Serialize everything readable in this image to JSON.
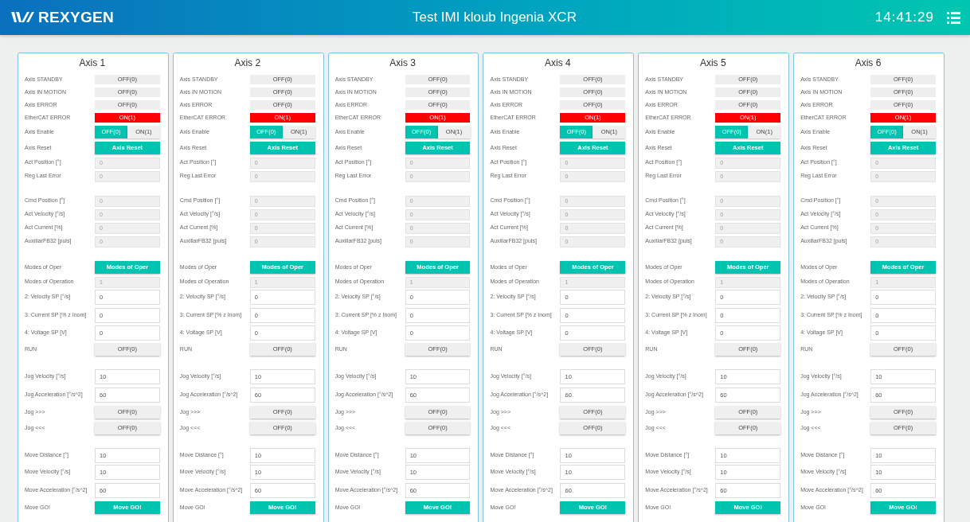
{
  "header": {
    "logo": "REXYGEN",
    "title": "Test IMI kloub Ingenia XCR",
    "time": "14:41:29"
  },
  "axes": [
    {
      "title": "Axis 1",
      "groups": [
        [
          {
            "kind": "indicator",
            "label": "Axis STANDBY",
            "value": "OFF(0)",
            "on": false
          },
          {
            "kind": "indicator",
            "label": "Axis IN MOTION",
            "value": "OFF(0)",
            "on": false
          },
          {
            "kind": "indicator",
            "label": "Axis ERROR",
            "value": "OFF(0)",
            "on": false
          },
          {
            "kind": "indicator",
            "label": "EtherCAT ERROR",
            "value": "ON(1)",
            "on": true
          },
          {
            "kind": "segmented",
            "label": "Axis Enable",
            "options": [
              {
                "label": "OFF(0)",
                "selected": true
              },
              {
                "label": "ON(1)",
                "selected": false
              }
            ]
          },
          {
            "kind": "button",
            "label": "Axis Reset",
            "value": "Axis Reset"
          },
          {
            "kind": "readout",
            "label": "Act Position [°]",
            "value": "0"
          },
          {
            "kind": "readout",
            "label": "Reg Last Error",
            "value": "0"
          }
        ],
        [
          {
            "kind": "readout",
            "label": "Cmd Position [°]",
            "value": "0"
          },
          {
            "kind": "readout",
            "label": "Act Velocity [°/s]",
            "value": "0"
          },
          {
            "kind": "readout",
            "label": "Act Current [%]",
            "value": "0"
          },
          {
            "kind": "readout",
            "label": "AuxiliarFB32 [puls]",
            "value": "0"
          }
        ],
        [
          {
            "kind": "button",
            "label": "Modes of Oper",
            "value": "Modes of Oper"
          },
          {
            "kind": "readout",
            "label": "Modes of Operation",
            "value": "1"
          },
          {
            "kind": "input",
            "label": "2: Velocity SP [°/s]",
            "value": "0"
          },
          {
            "kind": "input",
            "label": "3: Current SP [% z Inom]",
            "value": "0"
          },
          {
            "kind": "input",
            "label": "4: Voltage SP [V]",
            "value": "0"
          },
          {
            "kind": "switch",
            "label": "RUN",
            "value": "OFF(0)",
            "on": false
          }
        ],
        [
          {
            "kind": "input",
            "label": "Jog Velocity [°/s]",
            "value": "10"
          },
          {
            "kind": "input",
            "label": "Jog Acceleration [°/s^2]",
            "value": "60"
          },
          {
            "kind": "switch",
            "label": "Jog >>>",
            "value": "OFF(0)",
            "on": false
          },
          {
            "kind": "switch",
            "label": "Jog <<<",
            "value": "OFF(0)",
            "on": false
          }
        ],
        [
          {
            "kind": "input",
            "label": "Move Distance [°]",
            "value": "10"
          },
          {
            "kind": "input",
            "label": "Move Velocity [°/s]",
            "value": "10"
          },
          {
            "kind": "input",
            "label": "Move Acceleration [°/s^2]",
            "value": "60"
          },
          {
            "kind": "button",
            "label": "Move GO!",
            "value": "Move GO!"
          }
        ]
      ]
    },
    {
      "title": "Axis 2",
      "groups": [
        [
          {
            "kind": "indicator",
            "label": "Axis STANDBY",
            "value": "OFF(0)",
            "on": false
          },
          {
            "kind": "indicator",
            "label": "Axis IN MOTION",
            "value": "OFF(0)",
            "on": false
          },
          {
            "kind": "indicator",
            "label": "Axis ERROR",
            "value": "OFF(0)",
            "on": false
          },
          {
            "kind": "indicator",
            "label": "EtherCAT ERROR",
            "value": "ON(1)",
            "on": true
          },
          {
            "kind": "segmented",
            "label": "Axis Enable",
            "options": [
              {
                "label": "OFF(0)",
                "selected": true
              },
              {
                "label": "ON(1)",
                "selected": false
              }
            ]
          },
          {
            "kind": "button",
            "label": "Axis Reset",
            "value": "Axis Reset"
          },
          {
            "kind": "readout",
            "label": "Act Position [°]",
            "value": "0"
          },
          {
            "kind": "readout",
            "label": "Reg Last Error",
            "value": "0"
          }
        ],
        [
          {
            "kind": "readout",
            "label": "Cmd Position [°]",
            "value": "0"
          },
          {
            "kind": "readout",
            "label": "Act Velocity [°/s]",
            "value": "0"
          },
          {
            "kind": "readout",
            "label": "Act Current [%]",
            "value": "0"
          },
          {
            "kind": "readout",
            "label": "AuxiliarFB32 [puls]",
            "value": "0"
          }
        ],
        [
          {
            "kind": "button",
            "label": "Modes of Oper",
            "value": "Modes of Oper"
          },
          {
            "kind": "readout",
            "label": "Modes of Operation",
            "value": "1"
          },
          {
            "kind": "input",
            "label": "2: Velocity SP [°/s]",
            "value": "0"
          },
          {
            "kind": "input",
            "label": "3: Current SP [% z Inom]",
            "value": "0"
          },
          {
            "kind": "input",
            "label": "4: Voltage SP [V]",
            "value": "0"
          },
          {
            "kind": "switch",
            "label": "RUN",
            "value": "OFF(0)",
            "on": false
          }
        ],
        [
          {
            "kind": "input",
            "label": "Jog Velocity [°/s]",
            "value": "10"
          },
          {
            "kind": "input",
            "label": "Jog Acceleration [°/s^2]",
            "value": "60"
          },
          {
            "kind": "switch",
            "label": "Jog >>>",
            "value": "OFF(0)",
            "on": false
          },
          {
            "kind": "switch",
            "label": "Jog <<<",
            "value": "OFF(0)",
            "on": false
          }
        ],
        [
          {
            "kind": "input",
            "label": "Move Distance [°]",
            "value": "10"
          },
          {
            "kind": "input",
            "label": "Move Velocity [°/s]",
            "value": "10"
          },
          {
            "kind": "input",
            "label": "Move Acceleration [°/s^2]",
            "value": "60"
          },
          {
            "kind": "button",
            "label": "Move GO!",
            "value": "Move GO!"
          }
        ]
      ]
    },
    {
      "title": "Axis 3",
      "groups": [
        [
          {
            "kind": "indicator",
            "label": "Axis STANDBY",
            "value": "OFF(0)",
            "on": false
          },
          {
            "kind": "indicator",
            "label": "Axis IN MOTION",
            "value": "OFF(0)",
            "on": false
          },
          {
            "kind": "indicator",
            "label": "Axis ERROR",
            "value": "OFF(0)",
            "on": false
          },
          {
            "kind": "indicator",
            "label": "EtherCAT ERROR",
            "value": "ON(1)",
            "on": true
          },
          {
            "kind": "segmented",
            "label": "Axis Enable",
            "options": [
              {
                "label": "OFF(0)",
                "selected": true
              },
              {
                "label": "ON(1)",
                "selected": false
              }
            ]
          },
          {
            "kind": "button",
            "label": "Axis Reset",
            "value": "Axis Reset"
          },
          {
            "kind": "readout",
            "label": "Act Position [°]",
            "value": "0"
          },
          {
            "kind": "readout",
            "label": "Reg Last Error",
            "value": "0"
          }
        ],
        [
          {
            "kind": "readout",
            "label": "Cmd Position [°]",
            "value": "0"
          },
          {
            "kind": "readout",
            "label": "Act Velocity [°/s]",
            "value": "0"
          },
          {
            "kind": "readout",
            "label": "Act Current [%]",
            "value": "0"
          },
          {
            "kind": "readout",
            "label": "AuxiliarFB32 [puls]",
            "value": "0"
          }
        ],
        [
          {
            "kind": "button",
            "label": "Modes of Oper",
            "value": "Modes of Oper"
          },
          {
            "kind": "readout",
            "label": "Modes of Operation",
            "value": "1"
          },
          {
            "kind": "input",
            "label": "2: Velocity SP [°/s]",
            "value": "0"
          },
          {
            "kind": "input",
            "label": "3: Current SP [% z Inom]",
            "value": "0"
          },
          {
            "kind": "input",
            "label": "4: Voltage SP [V]",
            "value": "0"
          },
          {
            "kind": "switch",
            "label": "RUN",
            "value": "OFF(0)",
            "on": false
          }
        ],
        [
          {
            "kind": "input",
            "label": "Jog Velocity [°/s]",
            "value": "10"
          },
          {
            "kind": "input",
            "label": "Jog Acceleration [°/s^2]",
            "value": "60"
          },
          {
            "kind": "switch",
            "label": "Jog >>>",
            "value": "OFF(0)",
            "on": false
          },
          {
            "kind": "switch",
            "label": "Jog <<<",
            "value": "OFF(0)",
            "on": false
          }
        ],
        [
          {
            "kind": "input",
            "label": "Move Distance [°]",
            "value": "10"
          },
          {
            "kind": "input",
            "label": "Move Velocity [°/s]",
            "value": "10"
          },
          {
            "kind": "input",
            "label": "Move Acceleration [°/s^2]",
            "value": "60"
          },
          {
            "kind": "button",
            "label": "Move GO!",
            "value": "Move GO!"
          }
        ]
      ]
    },
    {
      "title": "Axis 4",
      "groups": [
        [
          {
            "kind": "indicator",
            "label": "Axis STANDBY",
            "value": "OFF(0)",
            "on": false
          },
          {
            "kind": "indicator",
            "label": "Axis IN MOTION",
            "value": "OFF(0)",
            "on": false
          },
          {
            "kind": "indicator",
            "label": "Axis ERROR",
            "value": "OFF(0)",
            "on": false
          },
          {
            "kind": "indicator",
            "label": "EtherCAT ERROR",
            "value": "ON(1)",
            "on": true
          },
          {
            "kind": "segmented",
            "label": "Axis Enable",
            "options": [
              {
                "label": "OFF(0)",
                "selected": true
              },
              {
                "label": "ON(1)",
                "selected": false
              }
            ]
          },
          {
            "kind": "button",
            "label": "Axis Reset",
            "value": "Axis Reset"
          },
          {
            "kind": "readout",
            "label": "Act Position [°]",
            "value": "0"
          },
          {
            "kind": "readout",
            "label": "Reg Last Error",
            "value": "0"
          }
        ],
        [
          {
            "kind": "readout",
            "label": "Cmd Position [°]",
            "value": "0"
          },
          {
            "kind": "readout",
            "label": "Act Velocity [°/s]",
            "value": "0"
          },
          {
            "kind": "readout",
            "label": "Act Current [%]",
            "value": "0"
          },
          {
            "kind": "readout",
            "label": "AuxiliarFB32 [puls]",
            "value": "0"
          }
        ],
        [
          {
            "kind": "button",
            "label": "Modes of Oper",
            "value": "Modes of Oper"
          },
          {
            "kind": "readout",
            "label": "Modes of Operation",
            "value": "1"
          },
          {
            "kind": "input",
            "label": "2: Velocity SP [°/s]",
            "value": "0"
          },
          {
            "kind": "input",
            "label": "3: Current SP [% z Inom]",
            "value": "0"
          },
          {
            "kind": "input",
            "label": "4: Voltage SP [V]",
            "value": "0"
          },
          {
            "kind": "switch",
            "label": "RUN",
            "value": "OFF(0)",
            "on": false
          }
        ],
        [
          {
            "kind": "input",
            "label": "Jog Velocity [°/s]",
            "value": "10"
          },
          {
            "kind": "input",
            "label": "Jog Acceleration [°/s^2]",
            "value": "60"
          },
          {
            "kind": "switch",
            "label": "Jog >>>",
            "value": "OFF(0)",
            "on": false
          },
          {
            "kind": "switch",
            "label": "Jog <<<",
            "value": "OFF(0)",
            "on": false
          }
        ],
        [
          {
            "kind": "input",
            "label": "Move Distance [°]",
            "value": "10"
          },
          {
            "kind": "input",
            "label": "Move Velocity [°/s]",
            "value": "10"
          },
          {
            "kind": "input",
            "label": "Move Acceleration [°/s^2]",
            "value": "60"
          },
          {
            "kind": "button",
            "label": "Move GO!",
            "value": "Move GO!"
          }
        ]
      ]
    },
    {
      "title": "Axis 5",
      "groups": [
        [
          {
            "kind": "indicator",
            "label": "Axis STANDBY",
            "value": "OFF(0)",
            "on": false
          },
          {
            "kind": "indicator",
            "label": "Axis IN MOTION",
            "value": "OFF(0)",
            "on": false
          },
          {
            "kind": "indicator",
            "label": "Axis ERROR",
            "value": "OFF(0)",
            "on": false
          },
          {
            "kind": "indicator",
            "label": "EtherCAT ERROR",
            "value": "ON(1)",
            "on": true
          },
          {
            "kind": "segmented",
            "label": "Axis Enable",
            "options": [
              {
                "label": "OFF(0)",
                "selected": true
              },
              {
                "label": "ON(1)",
                "selected": false
              }
            ]
          },
          {
            "kind": "button",
            "label": "Axis Reset",
            "value": "Axis Reset"
          },
          {
            "kind": "readout",
            "label": "Act Position [°]",
            "value": "0"
          },
          {
            "kind": "readout",
            "label": "Reg Last Error",
            "value": "0"
          }
        ],
        [
          {
            "kind": "readout",
            "label": "Cmd Position [°]",
            "value": "0"
          },
          {
            "kind": "readout",
            "label": "Act Velocity [°/s]",
            "value": "0"
          },
          {
            "kind": "readout",
            "label": "Act Current [%]",
            "value": "0"
          },
          {
            "kind": "readout",
            "label": "AuxiliarFB32 [puls]",
            "value": "0"
          }
        ],
        [
          {
            "kind": "button",
            "label": "Modes of Oper",
            "value": "Modes of Oper"
          },
          {
            "kind": "readout",
            "label": "Modes of Operation",
            "value": "1"
          },
          {
            "kind": "input",
            "label": "2: Velocity SP [°/s]",
            "value": "0"
          },
          {
            "kind": "input",
            "label": "3: Current SP [% z Inom]",
            "value": "0"
          },
          {
            "kind": "input",
            "label": "4: Voltage SP [V]",
            "value": "0"
          },
          {
            "kind": "switch",
            "label": "RUN",
            "value": "OFF(0)",
            "on": false
          }
        ],
        [
          {
            "kind": "input",
            "label": "Jog Velocity [°/s]",
            "value": "10"
          },
          {
            "kind": "input",
            "label": "Jog Acceleration [°/s^2]",
            "value": "60"
          },
          {
            "kind": "switch",
            "label": "Jog >>>",
            "value": "OFF(0)",
            "on": false
          },
          {
            "kind": "switch",
            "label": "Jog <<<",
            "value": "OFF(0)",
            "on": false
          }
        ],
        [
          {
            "kind": "input",
            "label": "Move Distance [°]",
            "value": "10"
          },
          {
            "kind": "input",
            "label": "Move Velocity [°/s]",
            "value": "10"
          },
          {
            "kind": "input",
            "label": "Move Acceleration [°/s^2]",
            "value": "60"
          },
          {
            "kind": "button",
            "label": "Move GO!",
            "value": "Move GO!"
          }
        ]
      ]
    },
    {
      "title": "Axis 6",
      "groups": [
        [
          {
            "kind": "indicator",
            "label": "Axis STANDBY",
            "value": "OFF(0)",
            "on": false
          },
          {
            "kind": "indicator",
            "label": "Axis IN MOTION",
            "value": "OFF(0)",
            "on": false
          },
          {
            "kind": "indicator",
            "label": "Axis ERROR",
            "value": "OFF(0)",
            "on": false
          },
          {
            "kind": "indicator",
            "label": "EtherCAT ERROR",
            "value": "ON(1)",
            "on": true
          },
          {
            "kind": "segmented",
            "label": "Axis Enable",
            "options": [
              {
                "label": "OFF(0)",
                "selected": true
              },
              {
                "label": "ON(1)",
                "selected": false
              }
            ]
          },
          {
            "kind": "button",
            "label": "Axis Reset",
            "value": "Axis Reset"
          },
          {
            "kind": "readout",
            "label": "Act Position [°]",
            "value": "0"
          },
          {
            "kind": "readout",
            "label": "Reg Last Error",
            "value": "0"
          }
        ],
        [
          {
            "kind": "readout",
            "label": "Cmd Position [°]",
            "value": "0"
          },
          {
            "kind": "readout",
            "label": "Act Velocity [°/s]",
            "value": "0"
          },
          {
            "kind": "readout",
            "label": "Act Current [%]",
            "value": "0"
          },
          {
            "kind": "readout",
            "label": "AuxiliarFB32 [puls]",
            "value": "0"
          }
        ],
        [
          {
            "kind": "button",
            "label": "Modes of Oper",
            "value": "Modes of Oper"
          },
          {
            "kind": "readout",
            "label": "Modes of Operation",
            "value": "1"
          },
          {
            "kind": "input",
            "label": "2: Velocity SP [°/s]",
            "value": "0"
          },
          {
            "kind": "input",
            "label": "3: Current SP [% z Inom]",
            "value": "0"
          },
          {
            "kind": "input",
            "label": "4: Voltage SP [V]",
            "value": "0"
          },
          {
            "kind": "switch",
            "label": "RUN",
            "value": "OFF(0)",
            "on": false
          }
        ],
        [
          {
            "kind": "input",
            "label": "Jog Velocity [°/s]",
            "value": "10"
          },
          {
            "kind": "input",
            "label": "Jog Acceleration [°/s^2]",
            "value": "60"
          },
          {
            "kind": "switch",
            "label": "Jog >>>",
            "value": "OFF(0)",
            "on": false
          },
          {
            "kind": "switch",
            "label": "Jog <<<",
            "value": "OFF(0)",
            "on": false
          }
        ],
        [
          {
            "kind": "input",
            "label": "Move Distance [°]",
            "value": "10"
          },
          {
            "kind": "input",
            "label": "Move Velocity [°/s]",
            "value": "10"
          },
          {
            "kind": "input",
            "label": "Move Acceleration [°/s^2]",
            "value": "60"
          },
          {
            "kind": "button",
            "label": "Move GO!",
            "value": "Move GO!"
          }
        ]
      ]
    }
  ]
}
